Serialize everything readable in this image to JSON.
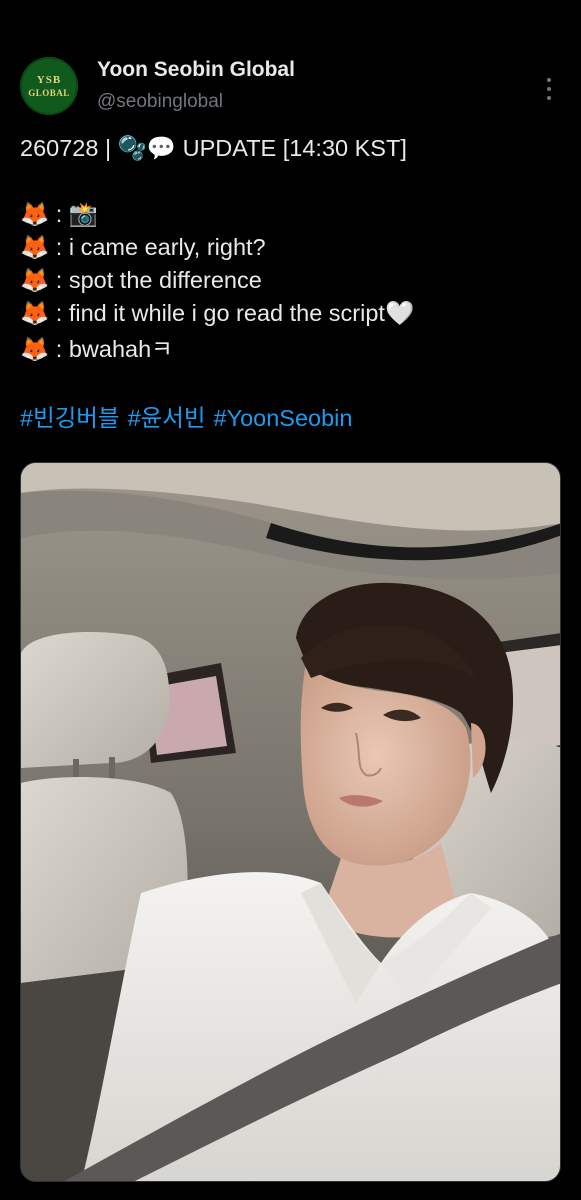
{
  "account": {
    "display_name": "Yoon Seobin Global",
    "handle": "@seobinglobal",
    "avatar_text_top": "YSB",
    "avatar_text_bottom": "GLOBAL"
  },
  "tweet": {
    "header_line": {
      "prefix": "260728 | ",
      "icons": "🫧💬",
      "suffix": " UPDATE [14:30 KST]"
    },
    "lines": [
      {
        "icon": "🦊",
        "text": " : 📸"
      },
      {
        "icon": "🦊",
        "text": " : i came early, right?"
      },
      {
        "icon": "🦊",
        "text": " : spot the difference"
      },
      {
        "icon": "🦊",
        "text": " : find it while i go read the script🤍"
      },
      {
        "icon": "🦊",
        "text": " : bwahahㅋ"
      }
    ],
    "hashtags": [
      "#빈깅버블",
      "#윤서빈",
      "#YoonSeobin"
    ]
  },
  "icons": {
    "line_icon": "fox-face-icon",
    "more": "more-options-icon"
  },
  "colors": {
    "background": "#000000",
    "text": "#e7e9ea",
    "secondary": "#71767b",
    "link": "#1d9bf0",
    "avatar_bg": "#0f5a1c",
    "avatar_text": "#e8d27a"
  }
}
